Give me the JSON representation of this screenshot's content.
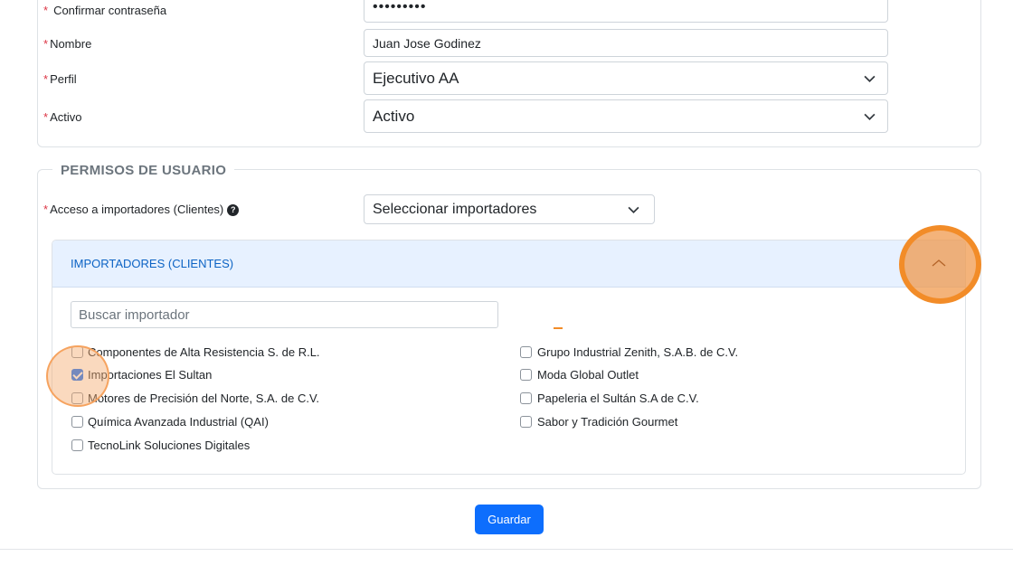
{
  "form": {
    "confirm_password": {
      "label": "Confirmar contraseña",
      "value": "•••••••••"
    },
    "nombre": {
      "label": "Nombre",
      "value": "Juan Jose Godinez"
    },
    "perfil": {
      "label": "Perfil",
      "value": "Ejecutivo AA"
    },
    "activo": {
      "label": "Activo",
      "value": "Activo"
    },
    "required_mark": "*"
  },
  "permissions": {
    "legend": "PERMISOS DE USUARIO",
    "access_label": "Acceso a importadores (Clientes)",
    "help_icon": "question-circle-icon",
    "access_select": "Seleccionar importadores",
    "panel_title": "IMPORTADORES (CLIENTES)",
    "search_placeholder": "Buscar importador",
    "importers_left": [
      {
        "name": "Componentes de Alta Resistencia S. de R.L.",
        "checked": false
      },
      {
        "name": "Importaciones El Sultan",
        "checked": true
      },
      {
        "name": "Motores de Precisión del Norte, S.A. de C.V.",
        "checked": false
      },
      {
        "name": "Química Avanzada Industrial (QAI)",
        "checked": false
      },
      {
        "name": "TecnoLink Soluciones Digitales",
        "checked": false
      }
    ],
    "importers_right": [
      {
        "name": "Grupo Industrial Zenith, S.A.B. de C.V.",
        "checked": false
      },
      {
        "name": "Moda Global Outlet",
        "checked": false
      },
      {
        "name": "Papeleria el Sultán S.A de C.V.",
        "checked": false
      },
      {
        "name": "Sabor y Tradición Gourmet",
        "checked": false
      }
    ]
  },
  "actions": {
    "save_label": "Guardar"
  },
  "colors": {
    "primary": "#0d6efd",
    "required": "#dc3545",
    "highlight": "#f28c28",
    "panel_header_bg": "#e7f1ff"
  }
}
